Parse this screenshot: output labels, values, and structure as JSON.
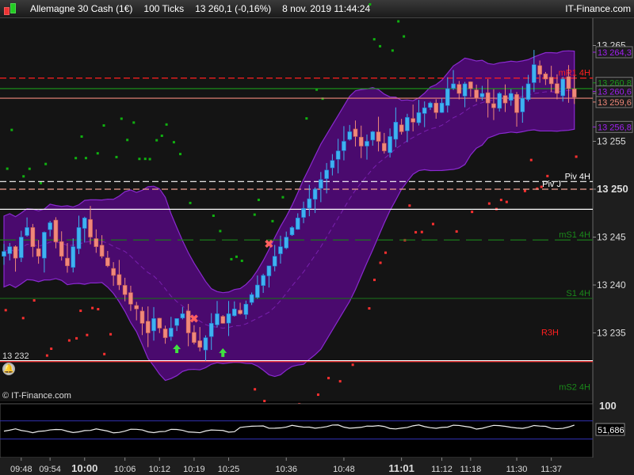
{
  "header": {
    "instrument": "Allemagne 30 Cash (1€)",
    "interval": "100 Ticks",
    "last": "13 260,1 (-0,16%)",
    "datetime": "8 nov. 2019 11:44:24",
    "brand": "IT-Finance.com"
  },
  "watermark": "© IT-Finance.com",
  "price_marker": "13 232",
  "colors": {
    "up": "#3fb2f0",
    "down": "#f0887a",
    "band": "#4a0a6e",
    "band_edge": "#8a2ad0",
    "green": "#1a8a1a",
    "red": "#ff2020"
  },
  "chart_data": {
    "type": "candlestick",
    "ylim": [
      13229.5,
      13268.5
    ],
    "price_ticks": [
      "13 265",
      "13 260",
      "13 255",
      "13 250",
      "13 245",
      "13 240",
      "13 235"
    ],
    "price_tick_values": [
      13265,
      13260,
      13255,
      13250,
      13245,
      13240,
      13235
    ],
    "bold_tick": "13 250",
    "closes": [
      13243.5,
      13244,
      13242.8,
      13245,
      13246,
      13244,
      13243,
      13245.5,
      13246.5,
      13244.5,
      13243,
      13242,
      13244,
      13246,
      13247,
      13245,
      13244,
      13243,
      13242,
      13241,
      13240,
      13239,
      13238,
      13237.5,
      13236,
      13235,
      13236.5,
      13235.5,
      13234.5,
      13235.5,
      13236.5,
      13237,
      13235,
      13234,
      13233.5,
      13234.5,
      13236,
      13237,
      13236,
      13237,
      13237.5,
      13237,
      13238,
      13239,
      13240,
      13241,
      13242,
      13243,
      13244,
      13245,
      13246,
      13247,
      13248,
      13249,
      13250,
      13251,
      13252,
      13253,
      13254,
      13255,
      13256,
      13255.5,
      13254.5,
      13255,
      13256,
      13255,
      13254,
      13255.5,
      13257,
      13256,
      13257.5,
      13257,
      13258,
      13258.5,
      13259,
      13258,
      13259,
      13260.5,
      13261,
      13260,
      13261,
      13260.5,
      13259.5,
      13260,
      13259,
      13258.5,
      13260,
      13259,
      13260,
      13258,
      13259.5,
      13261,
      13263,
      13262,
      13261.5,
      13261,
      13260,
      13261.5,
      13260.5,
      13259.6
    ],
    "levels": [
      {
        "label": "mR1 4H",
        "price": 13261.6,
        "color": "#ff2020",
        "style": "dash",
        "label_color": "#ff2020"
      },
      {
        "label": "",
        "price": 13260.5,
        "color": "#1a9a1a",
        "style": "solid"
      },
      {
        "label": "",
        "price": 13259.5,
        "color": "#f0887a",
        "style": "solid"
      },
      {
        "label": "Piv 4H",
        "price": 13250.8,
        "color": "#ffffff",
        "style": "dash",
        "label_color": "#ffffff"
      },
      {
        "label": "Piv J",
        "price": 13250,
        "color": "#f0a090",
        "style": "dash",
        "label_color": "#ffffff"
      },
      {
        "label": "",
        "price": 13247.9,
        "color": "#ffffff",
        "style": "solid"
      },
      {
        "label": "mS1 4H",
        "price": 13244.7,
        "color": "#1a7a1a",
        "style": "longdash",
        "label_color": "#1a8a1a"
      },
      {
        "label": "S1 4H",
        "price": 13238.6,
        "color": "#1a6a1a",
        "style": "solid",
        "label_color": "#1a8a1a"
      },
      {
        "label": "R3H",
        "price": 13234.5,
        "color": "none",
        "style": "none",
        "label_color": "#ff2020"
      },
      {
        "label": "",
        "price": 13232.1,
        "color": "#ffffff",
        "style": "solid"
      },
      {
        "label": "",
        "price": 13232,
        "color": "#ff2020",
        "style": "solid"
      },
      {
        "label": "mS2 4H",
        "price": 13228.8,
        "color": "none",
        "style": "none",
        "label_color": "#1a8a1a"
      }
    ],
    "price_boxes": [
      {
        "label": "13 264,3",
        "price": 13264.3,
        "color": "#a020f0"
      },
      {
        "label": "13 260,8",
        "price": 13261.1,
        "color": "#1a9a1a"
      },
      {
        "label": "13 260,6",
        "price": 13260.2,
        "color": "#a020f0"
      },
      {
        "label": "13 259,6",
        "price": 13259.1,
        "color": "#f0887a"
      },
      {
        "label": "13 256,8",
        "price": 13256.5,
        "color": "#a020f0"
      }
    ],
    "buy_arrows": [
      {
        "index": 30,
        "price": 13233.8
      },
      {
        "index": 38,
        "price": 13233.4
      }
    ],
    "sell_marks": [
      {
        "index": 46,
        "price": 13244.3
      },
      {
        "index": 33,
        "price": 13236.5
      }
    ],
    "time_ticks": [
      {
        "label": "09:48",
        "index": 3
      },
      {
        "label": "09:54",
        "index": 8
      },
      {
        "label": "10:00",
        "index": 14,
        "bold": true
      },
      {
        "label": "10:06",
        "index": 21
      },
      {
        "label": "10:12",
        "index": 27
      },
      {
        "label": "10:19",
        "index": 33
      },
      {
        "label": "10:25",
        "index": 39
      },
      {
        "label": "10:36",
        "index": 49
      },
      {
        "label": "10:48",
        "index": 59
      },
      {
        "label": "11:01",
        "index": 69,
        "bold": true
      },
      {
        "label": "11:12",
        "index": 76
      },
      {
        "label": "11:18",
        "index": 81
      },
      {
        "label": "11:30",
        "index": 89
      },
      {
        "label": "11:37",
        "index": 95
      }
    ],
    "oscillator": {
      "max_label": "100",
      "value_label": "51,686",
      "value": 51.686,
      "upper": 70,
      "lower": 33,
      "ylim": [
        0,
        100
      ]
    }
  }
}
